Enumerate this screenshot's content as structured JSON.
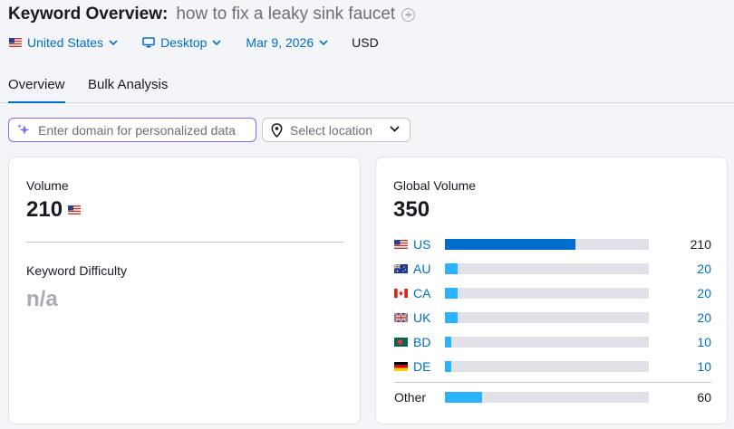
{
  "header": {
    "title": "Keyword Overview:",
    "keyword": "how to fix a leaky sink faucet"
  },
  "filters": {
    "country": "United States",
    "device": "Desktop",
    "date": "Mar 9, 2026",
    "currency": "USD"
  },
  "tabs": [
    {
      "label": "Overview",
      "active": true
    },
    {
      "label": "Bulk Analysis",
      "active": false
    }
  ],
  "inputs": {
    "domain_placeholder": "Enter domain for personalized data",
    "location_placeholder": "Select location"
  },
  "volume_card": {
    "volume_label": "Volume",
    "volume_value": "210",
    "kd_label": "Keyword Difficulty",
    "kd_value": "n/a"
  },
  "global_card": {
    "label": "Global Volume",
    "value": "350",
    "max_bar_value": 350,
    "rows": [
      {
        "code": "US",
        "value": "210",
        "num": 210,
        "primary": true
      },
      {
        "code": "AU",
        "value": "20",
        "num": 20,
        "primary": false
      },
      {
        "code": "CA",
        "value": "20",
        "num": 20,
        "primary": false
      },
      {
        "code": "UK",
        "value": "20",
        "num": 20,
        "primary": false
      },
      {
        "code": "BD",
        "value": "10",
        "num": 10,
        "primary": false
      },
      {
        "code": "DE",
        "value": "10",
        "num": 10,
        "primary": false
      }
    ],
    "other": {
      "label": "Other",
      "value": "60",
      "num": 60
    }
  },
  "colors": {
    "accent": "#006dca",
    "bar_secondary": "#2bb3ff",
    "bar_track": "#e0e1e9",
    "muted": "#a8aab4"
  }
}
